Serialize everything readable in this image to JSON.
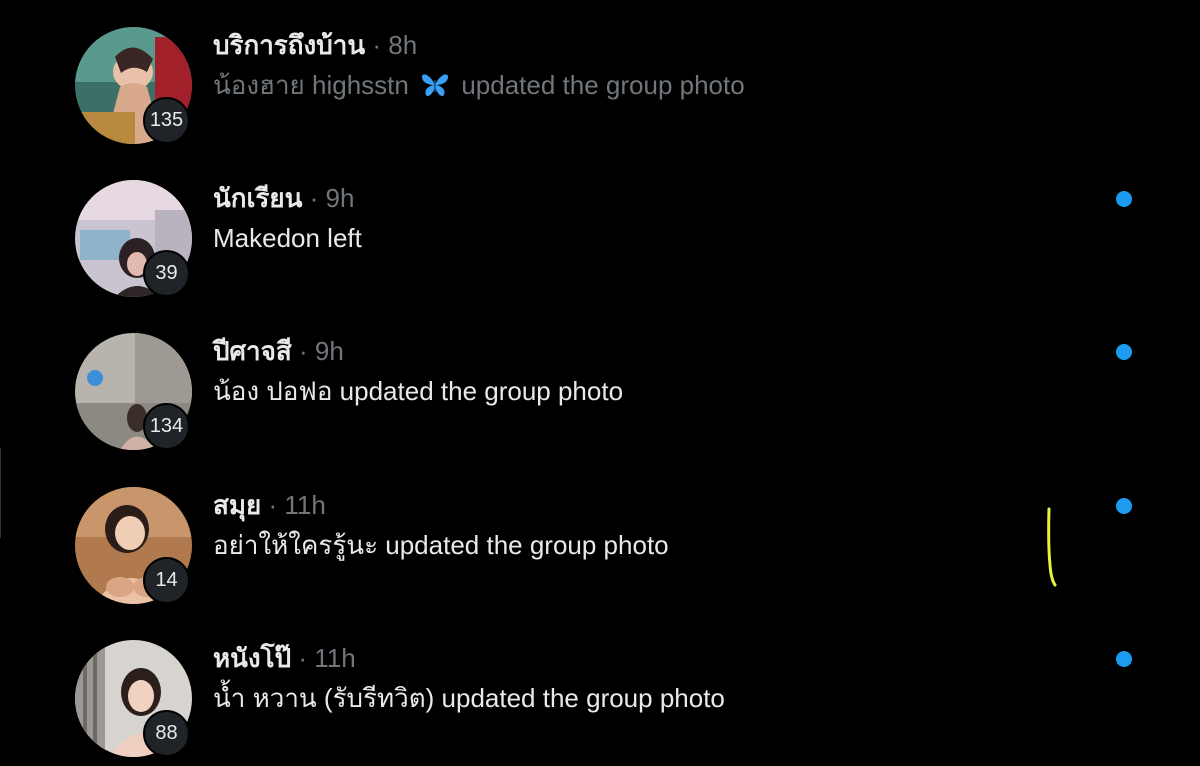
{
  "conversations": [
    {
      "name": "บริการถึงบ้าน",
      "separator": "·",
      "time": "8h",
      "preview_sender": "น้องฮาย highsstn",
      "preview_icon": "butterfly-icon",
      "preview_action": "updated the group photo",
      "member_count": "135",
      "unread": false
    },
    {
      "name": "นักเรียน",
      "separator": "·",
      "time": "9h",
      "preview": "Makedon left",
      "member_count": "39",
      "unread": true
    },
    {
      "name": "ปีศาจสี",
      "separator": "·",
      "time": "9h",
      "preview": "น้อง ปอฟอ updated the group photo",
      "member_count": "134",
      "unread": true
    },
    {
      "name": "สมุย ",
      "separator": "·",
      "time": "11h",
      "preview": "อย่าให้ใครรู้นะ updated the group photo",
      "member_count": "14",
      "unread": true
    },
    {
      "name": "หนังโป๊",
      "separator": "·",
      "time": "11h",
      "preview": "น้ำ หวาน (รับรีทวิต) updated the group photo",
      "member_count": "88",
      "unread": true
    }
  ],
  "colors": {
    "background": "#000000",
    "primary_text": "#e7e9ea",
    "secondary_text": "#71767b",
    "unread_dot": "#1d9bf0",
    "badge_bg": "#202327",
    "annotation": "#e6f23a"
  }
}
